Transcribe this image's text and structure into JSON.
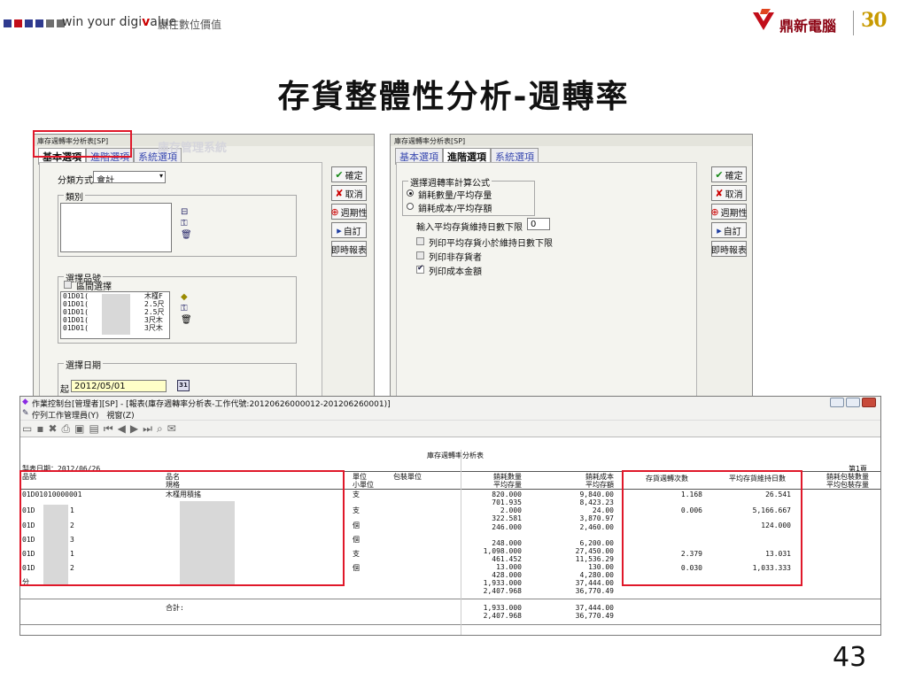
{
  "header": {
    "slogan_prefix": "win your digi",
    "slogan_accent": "v",
    "slogan_suffix": "alue",
    "slogan_cn": "贏在數位價值",
    "logo_name": "鼎新電腦",
    "logo_anniversary": "30",
    "brand_colors": [
      "#2f3a8f",
      "#c20d19",
      "#2f3a8f",
      "#2f3a8f",
      "#6e6e6e",
      "#6e6e6e"
    ]
  },
  "slide": {
    "title": "存貨整體性分析-週轉率",
    "page_number": "43"
  },
  "left_window": {
    "title": "庫存週轉率分析表[SP]",
    "tabs": [
      "基本選項",
      "進階選項",
      "系統選項"
    ],
    "active_tab": 0,
    "classify_label": "分類方式",
    "classify_value": "會計",
    "category_group": "類別",
    "item_group": "選擇品號",
    "range_checkbox": "區間選擇",
    "item_codes": [
      "01D01(",
      "01D01(",
      "01D01(",
      "01D01(",
      "01D01("
    ],
    "item_names": [
      "木槿F",
      "2.5尺",
      "2.5尺",
      "3尺木",
      "3尺木"
    ],
    "date_group": "選擇日期",
    "date_from_label": "起",
    "date_from_value": "2012/05/01",
    "calendar_icon_text": "31",
    "watermark_text": "庫存管理系統",
    "buttons": [
      "確定",
      "取消",
      "週期性",
      "自訂",
      "即時報表"
    ]
  },
  "right_window": {
    "title": "庫存週轉率分析表[SP]",
    "tabs": [
      "基本選項",
      "進階選項",
      "系統選項"
    ],
    "active_tab": 1,
    "formula_group": "選擇週轉率計算公式",
    "radio_1": "銷耗數量/平均存量",
    "radio_2": "銷耗成本/平均存額",
    "radio_selected": 1,
    "days_label": "輸入平均存貨維持日數下限",
    "days_value": "0",
    "check_1": "列印平均存貨小於維持日數下限",
    "check_2": "列印非存貨者",
    "check_3": "列印成本金額",
    "check_3_checked": true,
    "buttons": [
      "確定",
      "取消",
      "週期性",
      "自訂",
      "即時報表"
    ]
  },
  "report_window": {
    "title": "作業控制台[管理者][SP] - [報表(庫存週轉率分析表-工作代號:20120626000012-201206260001)]",
    "menu_1": "佇列工作管理員(Y)",
    "menu_2": "視窗(Z)",
    "report_title": "庫存週轉率分析表",
    "print_date": "製表日期：2012/06/26",
    "page": "第1頁",
    "headers": {
      "item_no": "品號",
      "item_name": "品名",
      "spec": "規格",
      "unit": "單位",
      "small_unit": "小單位",
      "pack_unit": "包裝單位",
      "qty1": "銷耗數量",
      "qty2": "平均存量",
      "cost1": "銷耗成本",
      "cost2": "平均存額",
      "turns": "存貨週轉次數",
      "days": "平均存貨維持日數",
      "pk1": "銷耗包裝數量",
      "pk2": "平均包裝存量"
    },
    "rows": [
      {
        "item_no": "01D01010000001",
        "item_name": "木槿用積搖",
        "unit": "支",
        "qty": [
          "820.000",
          "701.935"
        ],
        "cost": [
          "9,840.00",
          "8,423.23"
        ],
        "turns": "1.168",
        "days": "26.541"
      },
      {
        "item_no": "01D",
        "item_no_tail": "1",
        "unit": "支",
        "qty": [
          "2.000",
          "322.581"
        ],
        "cost": [
          "24.00",
          "3,870.97"
        ],
        "turns": "0.006",
        "days": "5,166.667"
      },
      {
        "item_no": "01D",
        "item_no_tail": "2",
        "unit": "個",
        "qty": [
          "246.000"
        ],
        "cost": [
          "2,460.00"
        ],
        "turns": "",
        "days": "124.000"
      },
      {
        "item_no": "01D",
        "item_no_tail": "3",
        "unit": "個",
        "qty": [
          "248.000"
        ],
        "cost": [
          "6,200.00"
        ],
        "turns": "",
        "days": ""
      },
      {
        "item_no": "01D",
        "item_no_tail": "1",
        "unit": "支",
        "qty": [
          "1,098.000",
          "461.452"
        ],
        "cost": [
          "27,450.00",
          "11,536.29"
        ],
        "turns": "2.379",
        "days": "13.031"
      },
      {
        "item_no": "01D",
        "item_no_tail": "2",
        "unit": "個",
        "qty": [
          "13.000"
        ],
        "cost": [
          "130.00"
        ],
        "turns": "0.030",
        "days": "1,033.333"
      },
      {
        "item_no": "分",
        "item_no_tail": "",
        "unit": "",
        "qty": [
          "428.000",
          "1,933.000",
          "2,407.968"
        ],
        "cost": [
          "4,280.00",
          "37,444.00",
          "36,770.49"
        ],
        "turns": "",
        "days": ""
      }
    ],
    "total_label": "合計:",
    "total_qty": [
      "1,933.000",
      "2,407.968"
    ],
    "total_cost": [
      "37,444.00",
      "36,770.49"
    ]
  }
}
